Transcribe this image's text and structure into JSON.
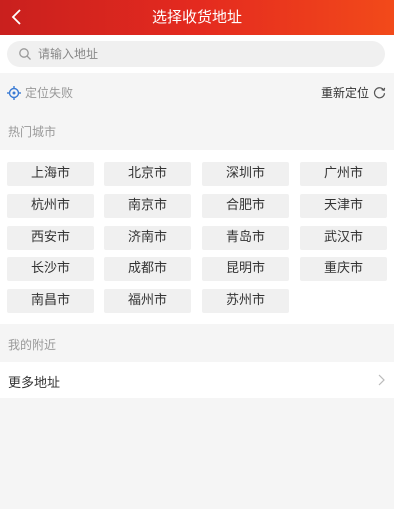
{
  "header": {
    "title": "选择收货地址"
  },
  "search": {
    "placeholder": "请输入地址"
  },
  "location": {
    "status": "定位失败",
    "relocate_label": "重新定位"
  },
  "hot_cities": {
    "label": "热门城市",
    "cities": [
      "上海市",
      "北京市",
      "深圳市",
      "广州市",
      "杭州市",
      "南京市",
      "合肥市",
      "天津市",
      "西安市",
      "济南市",
      "青岛市",
      "武汉市",
      "长沙市",
      "成都市",
      "昆明市",
      "重庆市",
      "南昌市",
      "福州市",
      "苏州市"
    ]
  },
  "nearby": {
    "label": "我的附近",
    "more_label": "更多地址"
  },
  "colors": {
    "header_start": "#c9201e",
    "header_end": "#f24a1a",
    "locate_icon": "#3a7bd5"
  }
}
